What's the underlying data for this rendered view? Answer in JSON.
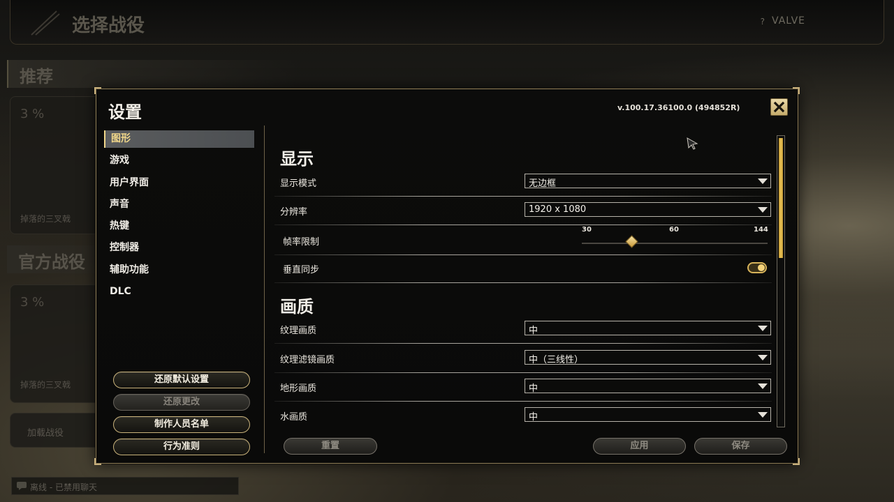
{
  "background": {
    "title": "选择战役",
    "help_icon": "?",
    "brand": "VALVE",
    "section_recommended": "推荐",
    "card1_percent": "3 %",
    "card1_name": "掉落的三叉戟",
    "section_official": "官方战役",
    "card2_percent": "3 %",
    "card2_name": "掉落的三叉戟",
    "load_campaign": "加载战役",
    "chat_status": "离线 - 已禁用聊天"
  },
  "dialog": {
    "title": "设置",
    "version": "v.100.17.36100.0 (494852R)",
    "close_icon": "close-icon"
  },
  "nav": {
    "items": [
      {
        "label": "图形",
        "active": true
      },
      {
        "label": "游戏"
      },
      {
        "label": "用户界面"
      },
      {
        "label": "声音"
      },
      {
        "label": "热键"
      },
      {
        "label": "控制器"
      },
      {
        "label": "辅助功能"
      },
      {
        "label": "DLC"
      }
    ]
  },
  "side_buttons": {
    "restore_defaults": "还原默认设置",
    "revert_changes": "还原更改",
    "credits": "制作人员名单",
    "code_of_conduct": "行为准则"
  },
  "display": {
    "title": "显示",
    "display_mode": {
      "label": "显示模式",
      "value": "无边框"
    },
    "resolution": {
      "label": "分辨率",
      "value": "1920 x 1080"
    },
    "frame_limit": {
      "label": "帧率限制",
      "ticks": [
        "30",
        "60",
        "144"
      ],
      "value_fraction": 0.27
    },
    "vsync": {
      "label": "垂直同步",
      "on": true
    }
  },
  "quality": {
    "title": "画质",
    "texture": {
      "label": "纹理画质",
      "value": "中"
    },
    "texture_filter": {
      "label": "纹理滤镜画质",
      "value": "中（三线性）"
    },
    "terrain": {
      "label": "地形画质",
      "value": "中"
    },
    "water": {
      "label": "水画质",
      "value": "中"
    }
  },
  "bottom_buttons": {
    "reset": "重置",
    "apply": "应用",
    "save": "保存"
  },
  "colors": {
    "accent_gold": "#c9b27a",
    "active_tab_text": "#f0d78a",
    "scroll_thumb": "#f0c858"
  }
}
